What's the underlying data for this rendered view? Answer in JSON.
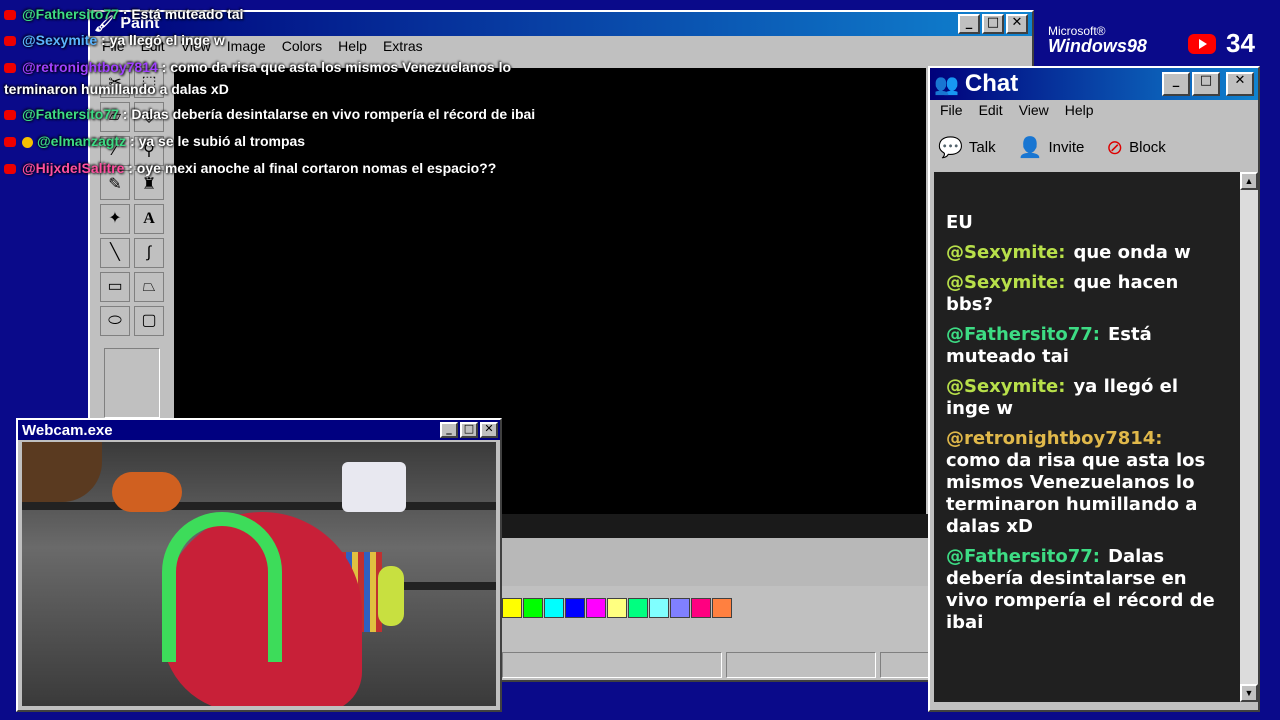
{
  "paint": {
    "title": "Paint",
    "menu": [
      "File",
      "Edit",
      "View",
      "Image",
      "Colors",
      "Help",
      "Extras"
    ],
    "palette": [
      "#ffff00",
      "#00ff00",
      "#00ffff",
      "#0000ff",
      "#ff00ff",
      "#ffff80",
      "#00ff80",
      "#80ffff",
      "#8080ff",
      "#ff0080",
      "#ff8040"
    ]
  },
  "overlay_chat": [
    {
      "user": "@Fathersito77",
      "text": ": Está muteado tai",
      "user_color": "#3ddc84"
    },
    {
      "user": "@Sexymite",
      "text": ": ya llegó el inge w",
      "user_color": "#5ab4ff"
    },
    {
      "user": "@retronightboy7814",
      "text": ": como da risa que asta los mismos Venezuelanos lo",
      "user_color": "#a040ff"
    },
    {
      "user": "",
      "text": "terminaron humillando a dalas xD",
      "user_color": "#ffffff"
    },
    {
      "user": "@Fathersito77",
      "text": ": Dalas debería desintalarse en vivo rompería el récord de ibai",
      "user_color": "#3ddc84"
    },
    {
      "user": "@elmanzagtz",
      "text": ": ya se le subió al trompas",
      "user_color": "#3ddc84"
    },
    {
      "user": "@HijxdelSalitre",
      "text": ": oye mexi anoche al final cortaron nomas el espacio??",
      "user_color": "#ff4fa0"
    }
  ],
  "chat": {
    "title": "Chat",
    "menu": [
      "File",
      "Edit",
      "View",
      "Help"
    ],
    "toolbar": {
      "talk": "Talk",
      "invite": "Invite",
      "block": "Block"
    },
    "messages": [
      {
        "user": "",
        "text": "EU",
        "color": "#ffffff"
      },
      {
        "user": "@Sexymite:",
        "text": "que onda w",
        "color": "#b8e04a"
      },
      {
        "user": "@Sexymite:",
        "text": "que hacen bbs?",
        "color": "#b8e04a"
      },
      {
        "user": "@Fathersito77:",
        "text": "Está muteado tai",
        "color": "#3ddc84"
      },
      {
        "user": "@Sexymite:",
        "text": "ya llegó el inge w",
        "color": "#b8e04a"
      },
      {
        "user": "@retronightboy7814:",
        "text": "como da risa que asta los mismos Venezuelanos lo terminaron humillando a dalas xD",
        "color": "#e0b84a"
      },
      {
        "user": "@Fathersito77:",
        "text": "Dalas debería desintalarse en vivo rompería el récord de ibai",
        "color": "#3ddc84"
      }
    ]
  },
  "webcam": {
    "title": "Webcam.exe"
  },
  "branding": {
    "microsoft": "Microsoft®",
    "windows": "Windows98",
    "viewer_count": "34"
  },
  "window_buttons": {
    "min": "_",
    "max": "□",
    "close": "✕"
  }
}
